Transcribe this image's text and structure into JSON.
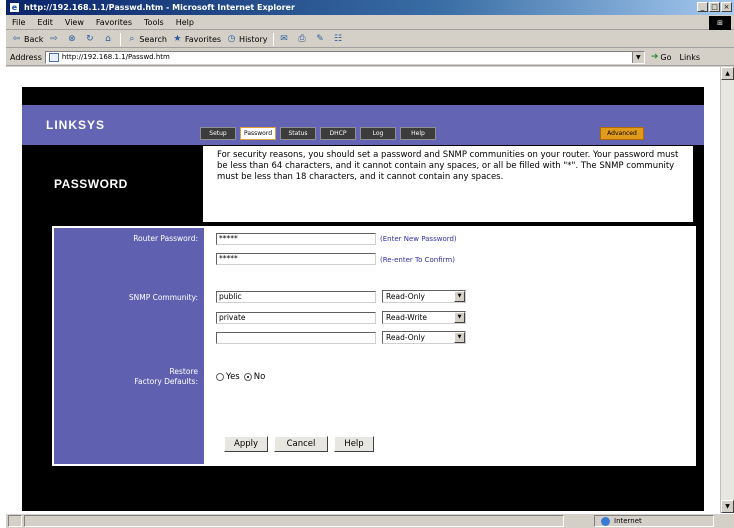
{
  "window": {
    "title": "http://192.168.1.1/Passwd.htm - Microsoft Internet Explorer",
    "brand_icon": "windows-logo-icon"
  },
  "menubar": [
    "File",
    "Edit",
    "View",
    "Favorites",
    "Tools",
    "Help"
  ],
  "toolbar": {
    "back": "Back",
    "search": "Search",
    "favorites": "Favorites",
    "history": "History"
  },
  "address": {
    "label": "Address",
    "url": "http://192.168.1.1/Passwd.htm",
    "go": "Go",
    "links": "Links"
  },
  "statusbar": {
    "zone": "Internet"
  },
  "linksys": {
    "logo": "LINKSYS",
    "tabs": [
      "Setup",
      "Password",
      "Status",
      "DHCP",
      "Log",
      "Help"
    ],
    "active_tab": "Password",
    "advanced": "Advanced",
    "page_title": "PASSWORD",
    "description": "For security reasons, you should set a password and SNMP communities on your router. Your password must be less than 64 characters, and it cannot contain any spaces, or all be filled with \"*\". The SNMP community must be less than 18 characters, and it cannot contain any spaces."
  },
  "form": {
    "router_password_label": "Router Password:",
    "password_value": "*****",
    "confirm_value": "*****",
    "enter_hint": "(Enter New Password)",
    "reenter_hint": "(Re-enter To Confirm)",
    "snmp_label": "SNMP Community:",
    "communities": [
      {
        "name": "public",
        "access": "Read-Only"
      },
      {
        "name": "private",
        "access": "Read-Write"
      },
      {
        "name": "",
        "access": "Read-Only"
      }
    ],
    "restore_label_line1": "Restore",
    "restore_label_line2": "Factory Defaults:",
    "yes": "Yes",
    "no": "No",
    "selected_restore": "No",
    "apply": "Apply",
    "cancel": "Cancel",
    "help": "Help"
  }
}
